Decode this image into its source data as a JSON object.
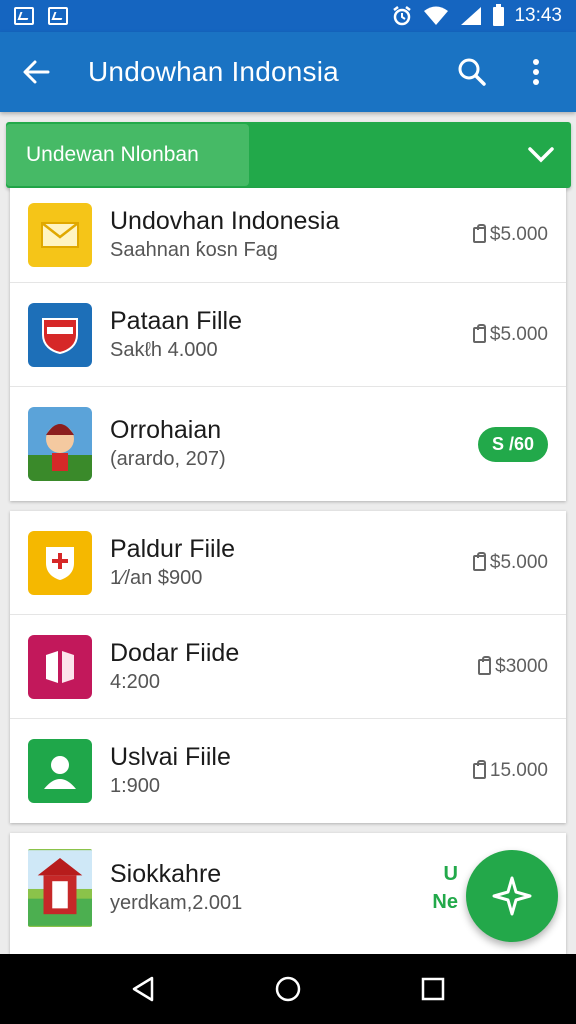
{
  "status_bar": {
    "time": "13:43"
  },
  "app_bar": {
    "title": "Undowhan Indonsia"
  },
  "filter": {
    "chip_label": "Undewan Nlonban"
  },
  "cards": [
    {
      "rows": [
        {
          "title": "Undovhan Indonesia",
          "subtitle": "Saahnan ƙosn Fag",
          "price": "$5.000",
          "price_kind": "locked",
          "icon": "envelope-icon"
        },
        {
          "title": "Pataan Fille",
          "subtitle": "Sakℓh 4.000",
          "price": "$5.000",
          "price_kind": "locked",
          "icon": "shield-badge-icon"
        },
        {
          "title": "Orrohaian",
          "subtitle": "(arardo, 207)",
          "price": "S /60",
          "price_kind": "pill",
          "icon": "character-avatar-icon"
        }
      ]
    },
    {
      "rows": [
        {
          "title": "Paldur Fiile",
          "subtitle": "1⁄/an $900",
          "price": "$5.000",
          "price_kind": "locked",
          "icon": "shield-cross-icon"
        },
        {
          "title": "Dodar Fiide",
          "subtitle": "4:200",
          "price": "$3000",
          "price_kind": "locked",
          "icon": "fold-icon"
        },
        {
          "title": "Uslvai Fiile",
          "subtitle": "1:900",
          "price": "15.000",
          "price_kind": "locked",
          "icon": "person-icon"
        }
      ]
    },
    {
      "rows": [
        {
          "title": "Siokkahre",
          "subtitle": "yerdkam,2.001",
          "price": "U\nNe",
          "price_kind": "green",
          "icon": "shrine-icon"
        }
      ]
    }
  ],
  "colors": {
    "appbar": "#1a73c3",
    "statusbar": "#1565c0",
    "accent_green": "#22a94a"
  }
}
